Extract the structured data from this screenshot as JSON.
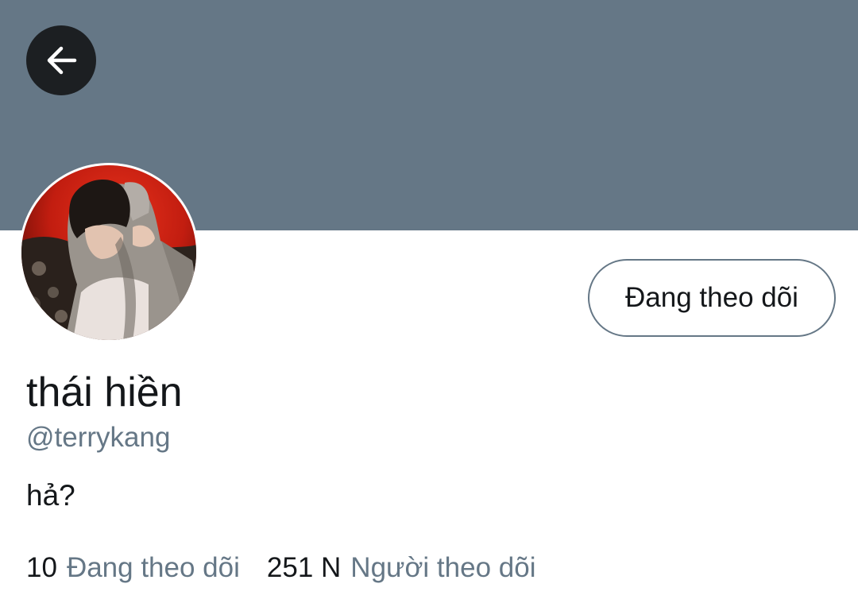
{
  "header": {
    "banner_color": "#657786",
    "back_icon": "arrow-left-icon"
  },
  "profile": {
    "avatar_icon": "profile-photo",
    "display_name": "thái hiền",
    "handle": "@terrykang",
    "bio": "hả?",
    "follow_button_label": "Đang theo dõi"
  },
  "stats": {
    "following_count": "10",
    "following_label": "Đang theo dõi",
    "followers_count": "251 N",
    "followers_label": "Người theo dõi"
  },
  "colors": {
    "primary_text": "#14171a",
    "secondary_text": "#657786"
  }
}
